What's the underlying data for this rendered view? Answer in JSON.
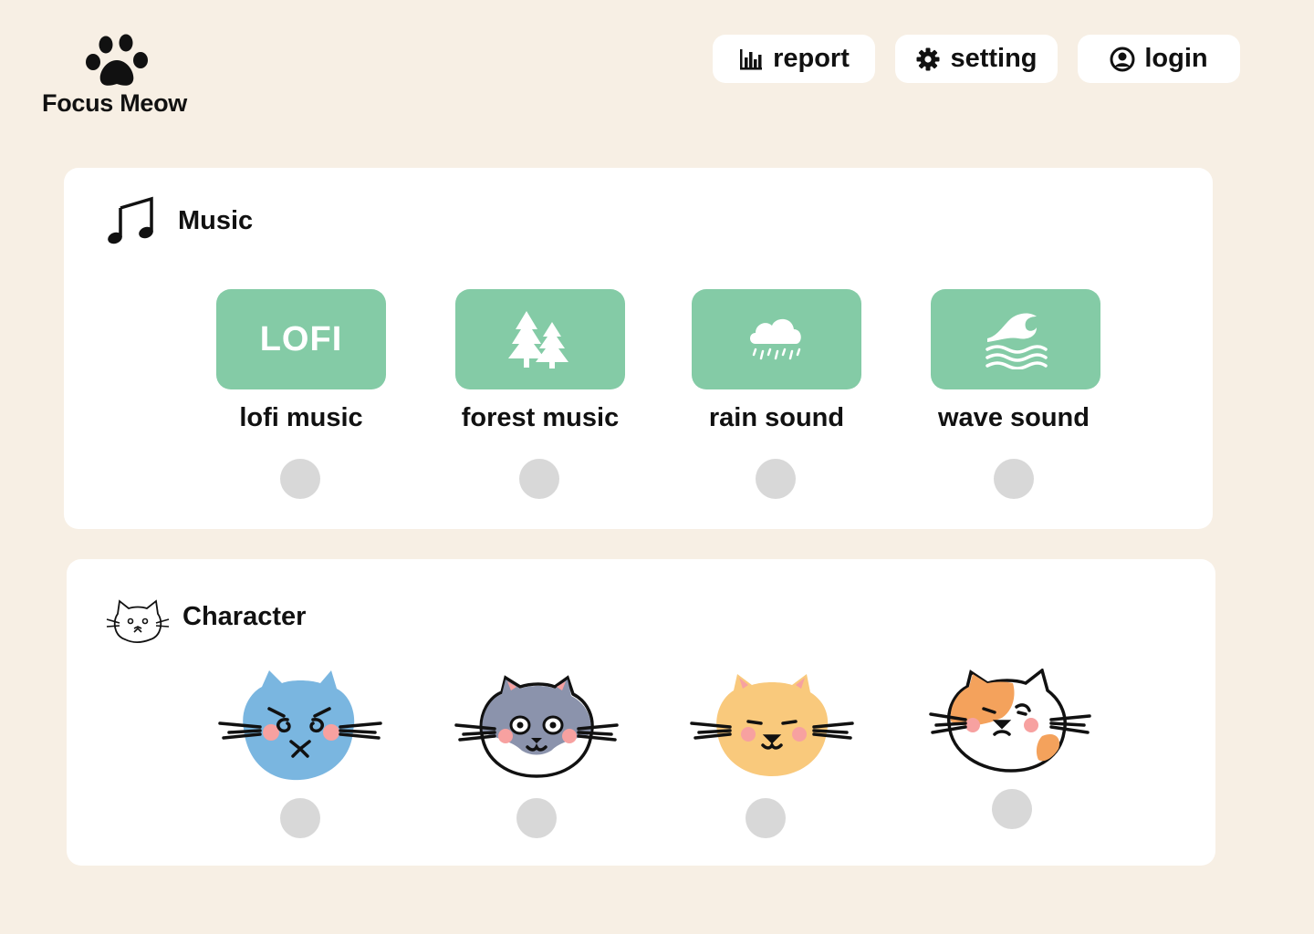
{
  "app": {
    "name": "Focus Meow",
    "logo_icon": "paw-icon"
  },
  "header": {
    "report_label": "report",
    "setting_label": "setting",
    "login_label": "login",
    "report_icon": "bar-chart-icon",
    "setting_icon": "gear-icon",
    "login_icon": "user-circle-icon"
  },
  "music": {
    "title": "Music",
    "title_icon": "music-note-icon",
    "items": [
      {
        "label": "lofi music",
        "tile_text": "LOFI",
        "icon": "lofi-text",
        "selected": false
      },
      {
        "label": "forest music",
        "icon": "pine-trees-icon",
        "selected": false
      },
      {
        "label": "rain sound",
        "icon": "rain-cloud-icon",
        "selected": false
      },
      {
        "label": "wave sound",
        "icon": "wave-icon",
        "selected": false
      }
    ]
  },
  "character": {
    "title": "Character",
    "title_icon": "cat-face-icon",
    "items": [
      {
        "name": "blue-cat",
        "color": "#7ab6e0",
        "selected": false
      },
      {
        "name": "gray-tuxedo-cat",
        "color": "#8b93ac",
        "selected": false
      },
      {
        "name": "orange-cat",
        "color": "#f9c97c",
        "selected": false
      },
      {
        "name": "calico-cat",
        "color": "#f4a25c",
        "selected": false
      }
    ]
  },
  "colors": {
    "background": "#f7efe4",
    "card": "#ffffff",
    "tile_green": "#84cba6",
    "radio_unselected": "#d8d8d8",
    "blush": "#f7a1a0"
  }
}
